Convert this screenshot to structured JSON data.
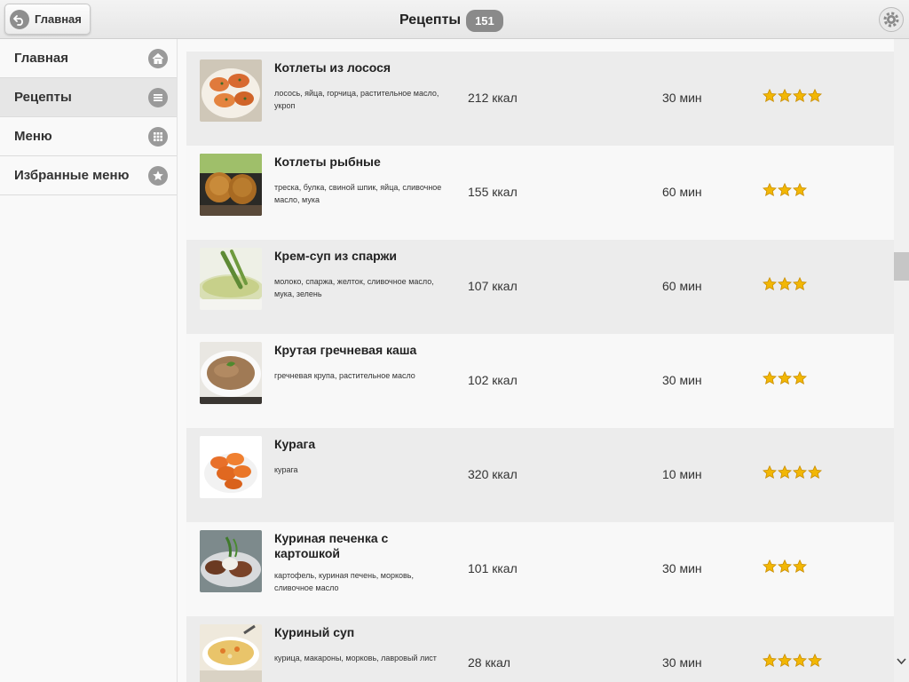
{
  "header": {
    "back_label": "Главная",
    "title": "Рецепты",
    "count": "151"
  },
  "sidebar": {
    "items": [
      {
        "label": "Главная",
        "icon": "home-icon"
      },
      {
        "label": "Рецепты",
        "icon": "list-icon",
        "active": true
      },
      {
        "label": "Меню",
        "icon": "grid-icon"
      },
      {
        "label": "Избранные меню",
        "icon": "star-icon"
      }
    ]
  },
  "recipes": [
    {
      "name": "Котлеты из лосося",
      "ingredients": "лосось, яйца, горчица, растительное масло, укроп",
      "kcal": "212 ккал",
      "time": "30 мин",
      "rating": 4
    },
    {
      "name": "Котлеты рыбные",
      "ingredients": "треска, булка, свиной шпик, яйца, сливочное масло, мука",
      "kcal": "155 ккал",
      "time": "60 мин",
      "rating": 3
    },
    {
      "name": "Крем-суп из спаржи",
      "ingredients": "молоко, спаржа, желток, сливочное масло, мука, зелень",
      "kcal": "107 ккал",
      "time": "60 мин",
      "rating": 3
    },
    {
      "name": "Крутая гречневая каша",
      "ingredients": "гречневая крупа, растительное масло",
      "kcal": "102 ккал",
      "time": "30 мин",
      "rating": 3
    },
    {
      "name": "Курага",
      "ingredients": "курага",
      "kcal": "320 ккал",
      "time": "10 мин",
      "rating": 4
    },
    {
      "name": "Куриная печенка с картошкой",
      "ingredients": "картофель, куриная печень, морковь, сливочное масло",
      "kcal": "101 ккал",
      "time": "30 мин",
      "rating": 3
    },
    {
      "name": "Куриный суп",
      "ingredients": "курица, макароны, морковь, лавровый лист",
      "kcal": "28 ккал",
      "time": "30 мин",
      "rating": 4
    }
  ],
  "colors": {
    "header_bg": "#e9e9e9",
    "row_dark": "#ececec",
    "row_light": "#f8f8f8",
    "badge": "#8a8a8a",
    "star": "#f2b705"
  }
}
